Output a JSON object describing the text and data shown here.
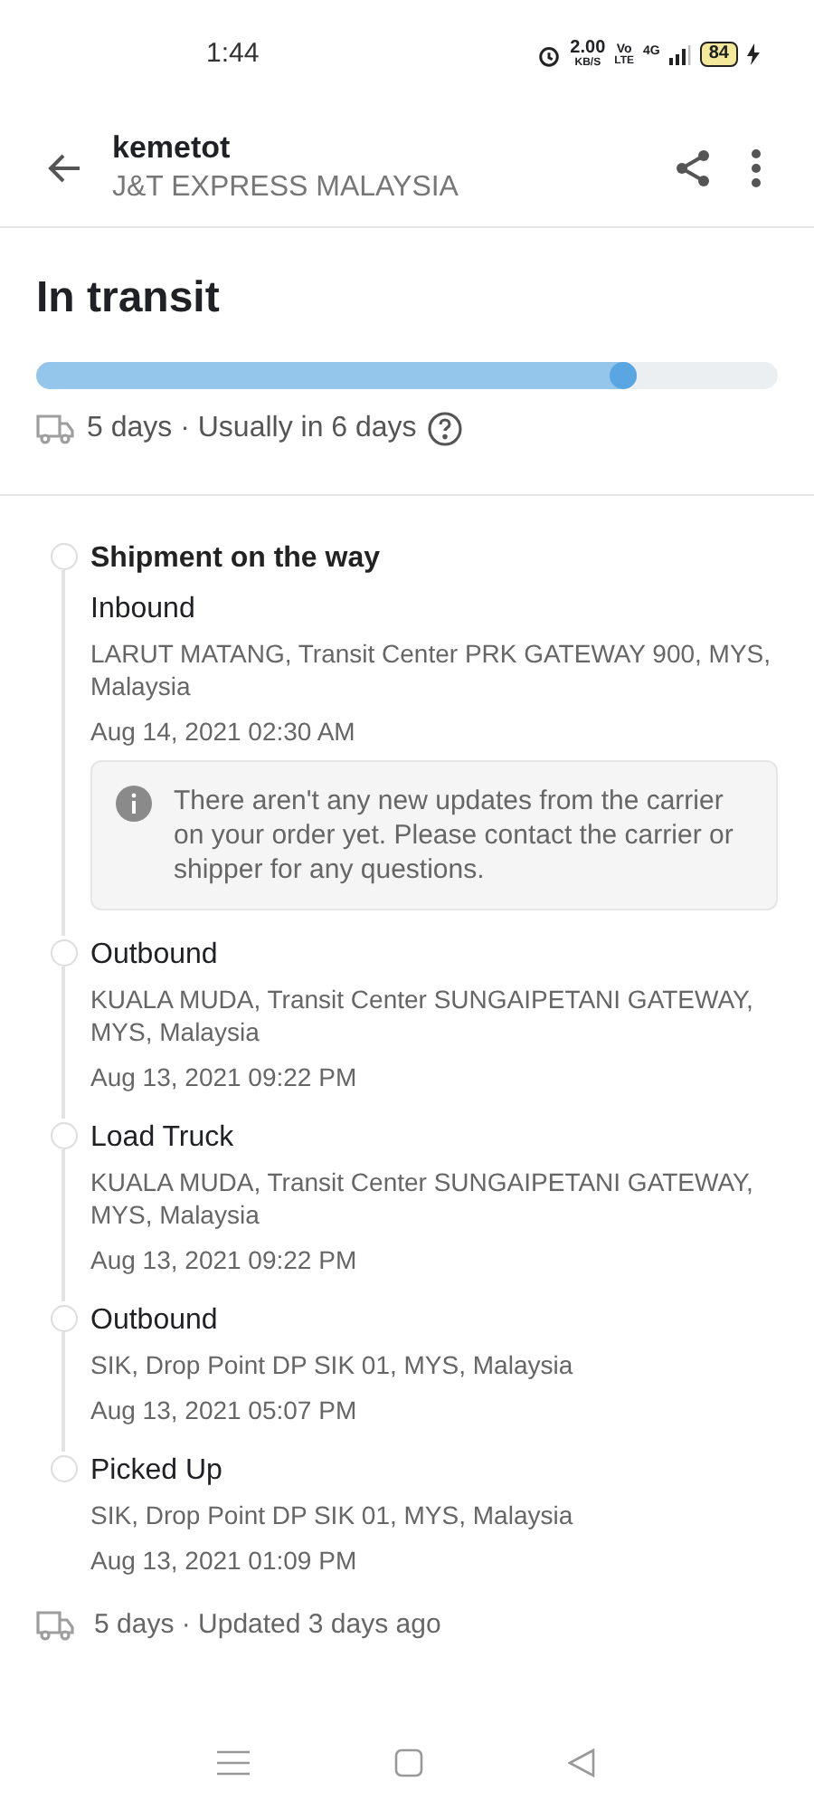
{
  "status_bar": {
    "time": "1:44",
    "speed": "2.00",
    "speed_unit": "KB/S",
    "volte_top": "Vo",
    "volte_bottom": "LTE",
    "network": "4G",
    "battery": "84"
  },
  "header": {
    "title": "kemetot",
    "subtitle": "J&T EXPRESS MALAYSIA"
  },
  "summary": {
    "status": "In transit",
    "progress": {
      "level": 0.81
    },
    "estimate": "5 days · Usually in 6 days"
  },
  "timeline": [
    {
      "heading": "Shipment on the way",
      "title": "Inbound",
      "location": "LARUT MATANG, Transit Center PRK GATEWAY 900, MYS, Malaysia",
      "time": "Aug 14, 2021 02:30 AM",
      "note": "There aren't any new updates from the carrier on your order yet. Please contact the carrier or shipper for any questions."
    },
    {
      "title": "Outbound",
      "location": "KUALA MUDA, Transit Center SUNGAIPETANI GATEWAY, MYS, Malaysia",
      "time": "Aug 13, 2021 09:22 PM"
    },
    {
      "title": "Load Truck",
      "location": "KUALA MUDA, Transit Center SUNGAIPETANI GATEWAY, MYS, Malaysia",
      "time": "Aug 13, 2021 09:22 PM"
    },
    {
      "title": "Outbound",
      "location": "SIK, Drop Point DP SIK 01, MYS, Malaysia",
      "time": "Aug 13, 2021 05:07 PM"
    },
    {
      "title": "Picked Up",
      "location": "SIK, Drop Point DP SIK 01, MYS, Malaysia",
      "time": "Aug 13, 2021 01:09 PM"
    }
  ],
  "footer": {
    "text": "5 days · Updated 3 days ago"
  }
}
